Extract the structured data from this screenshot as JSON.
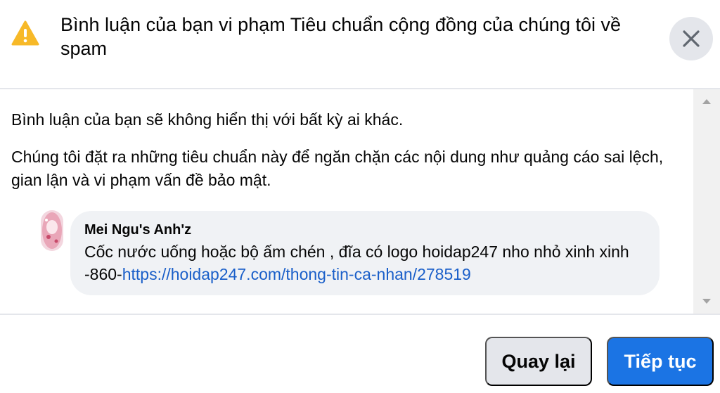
{
  "dialog": {
    "title": "Bình luận của bạn vi phạm Tiêu chuẩn cộng đồng của chúng tôi về spam",
    "warning_color": "#f7b928",
    "close_icon": "close-icon"
  },
  "body": {
    "paragraph1": "Bình luận của bạn sẽ không hiển thị với bất kỳ ai khác.",
    "paragraph2": "Chúng tôi đặt ra những tiêu chuẩn này để ngăn chặn các nội dung như quảng cáo sai lệch, gian lận và vi phạm vấn đề bảo mật.",
    "comment": {
      "author": "Mei Ngu's Anh'z",
      "text": "Cốc nước uống hoặc bộ ấm chén , đĩa có logo hoidap247 nho nhỏ xinh xinh -860-",
      "link": "https://hoidap247.com/thong-tin-ca-nhan/278519",
      "link_color": "#1a5fc9"
    }
  },
  "footer": {
    "back_label": "Quay lại",
    "next_label": "Tiếp tục",
    "primary_color": "#1b74e4"
  }
}
